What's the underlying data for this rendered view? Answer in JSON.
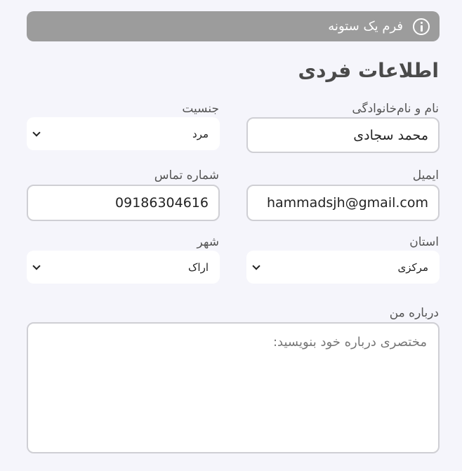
{
  "banner": {
    "text": "فرم یک ستونه",
    "icon": "info-icon"
  },
  "section": {
    "title": "اطلاعات فردی"
  },
  "form": {
    "full_name": {
      "label": "نام و نام‌خانوادگی",
      "value": "محمد سجادی"
    },
    "gender": {
      "label": "جنسیت",
      "value": "مرد"
    },
    "email": {
      "label": "ایمیل",
      "value": "hammadsjh@gmail.com"
    },
    "phone": {
      "label": "شماره تماس",
      "value": "09186304616"
    },
    "province": {
      "label": "استان",
      "value": "مرکزی"
    },
    "city": {
      "label": "شهر",
      "value": "اراک"
    },
    "about": {
      "label": "درباره من",
      "placeholder": "مختصری درباره خود بنویسید:"
    }
  }
}
